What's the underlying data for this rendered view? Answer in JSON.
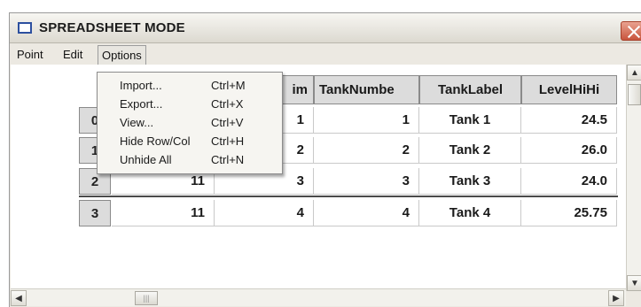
{
  "window": {
    "title": "SPREADSHEET MODE"
  },
  "menubar": {
    "items": [
      "Point",
      "Edit",
      "Options"
    ]
  },
  "options_menu": {
    "items": [
      {
        "label": "Import...",
        "shortcut": "Ctrl+M"
      },
      {
        "label": "Export...",
        "shortcut": "Ctrl+X"
      },
      {
        "label": "View...",
        "shortcut": "Ctrl+V"
      },
      {
        "label": "Hide Row/Col",
        "shortcut": "Ctrl+H"
      },
      {
        "label": "Unhide All",
        "shortcut": "Ctrl+N"
      }
    ]
  },
  "grid": {
    "columns": [
      "",
      "im",
      "TankNumbe",
      "TankLabel",
      "LevelHiHi"
    ],
    "rows": [
      {
        "header": "0",
        "cells": [
          "",
          "1",
          "1",
          "Tank 1",
          "24.5"
        ]
      },
      {
        "header": "1",
        "cells": [
          "",
          "2",
          "2",
          "Tank 2",
          "26.0"
        ]
      },
      {
        "header": "2",
        "cells": [
          "11",
          "3",
          "3",
          "Tank 3",
          "24.0"
        ]
      },
      {
        "header": "3",
        "cells": [
          "11",
          "4",
          "4",
          "Tank 4",
          "25.75"
        ]
      }
    ]
  },
  "scroll": {
    "up": "▲",
    "down": "▼",
    "left": "◀",
    "right": "▶",
    "thumb_grip": "|||"
  }
}
